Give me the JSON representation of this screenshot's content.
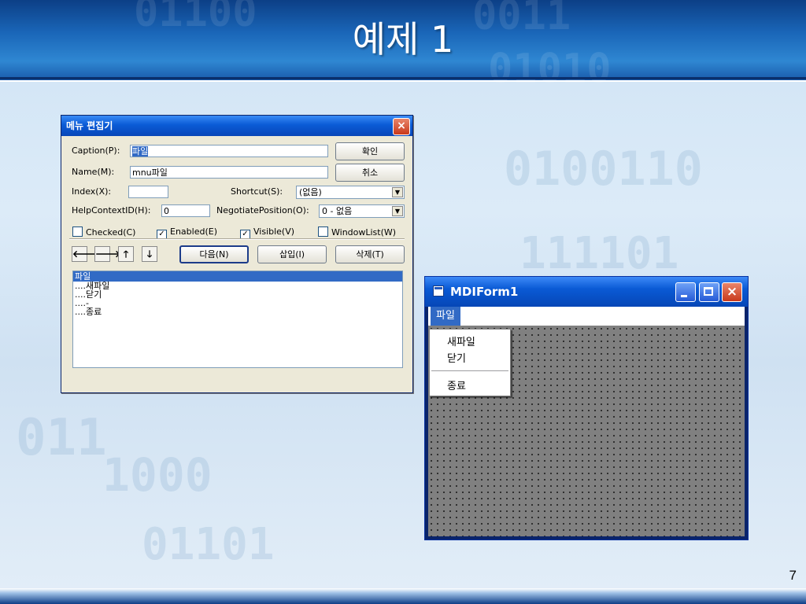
{
  "slide": {
    "title": "예제 1",
    "page_number": "7"
  },
  "menu_editor": {
    "title": "메뉴 편집기",
    "caption": {
      "label": "Caption(P):",
      "value": "파일"
    },
    "name": {
      "label": "Name(M):",
      "value": "mnu파일"
    },
    "index": {
      "label": "Index(X):",
      "value": ""
    },
    "shortcut": {
      "label": "Shortcut(S):",
      "value": "(없음)"
    },
    "help_context_id": {
      "label": "HelpContextID(H):",
      "value": "0"
    },
    "negotiate_position": {
      "label": "NegotiatePosition(O):",
      "value": "0 - 없음"
    },
    "checkboxes": [
      {
        "label": "Checked(C)",
        "checked": false
      },
      {
        "label": "Enabled(E)",
        "checked": true
      },
      {
        "label": "Visible(V)",
        "checked": true
      },
      {
        "label": "WindowList(W)",
        "checked": false
      }
    ],
    "buttons": {
      "ok": "확인",
      "cancel": "취소",
      "next": "다음(N)",
      "insert": "삽입(I)",
      "delete": "삭제(T)"
    },
    "arrow_buttons": [
      {
        "name": "move-left",
        "glyph": "🡐"
      },
      {
        "name": "move-right",
        "glyph": "🡒"
      },
      {
        "name": "move-up",
        "glyph": "🡑"
      },
      {
        "name": "move-down",
        "glyph": "🡓"
      }
    ],
    "list_items": [
      "파일",
      "....새파일",
      "....닫기",
      "....-",
      "....종료"
    ]
  },
  "mdi_form": {
    "title": "MDIForm1",
    "menu_bar_item": "파일",
    "popup_items": [
      "새파일",
      "닫기",
      "종료"
    ],
    "controls": {
      "minimize": "minimize",
      "maximize": "maximize",
      "close": "×"
    }
  },
  "colors": {
    "titlebar_blue": "#0a5bd6",
    "selection": "#316ac5",
    "dialog_face": "#ece9d8",
    "mdi_client": "#808080",
    "close_red": "#c9391b"
  }
}
